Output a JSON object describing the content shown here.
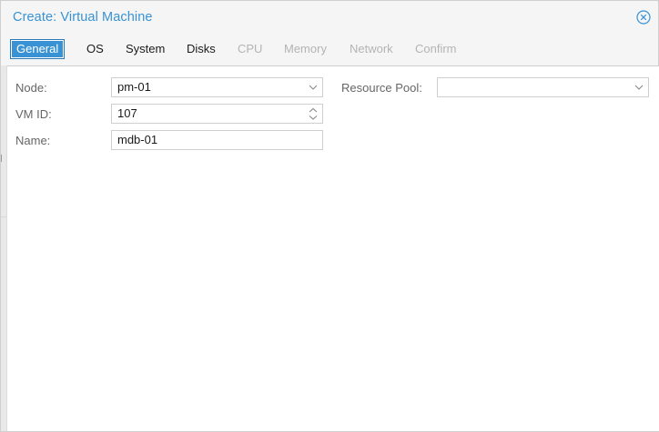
{
  "window": {
    "title": "Create: Virtual Machine"
  },
  "tabs": [
    {
      "label": "General",
      "active": true,
      "enabled": true
    },
    {
      "label": "OS",
      "active": false,
      "enabled": true
    },
    {
      "label": "System",
      "active": false,
      "enabled": true
    },
    {
      "label": "Disks",
      "active": false,
      "enabled": true
    },
    {
      "label": "CPU",
      "active": false,
      "enabled": false
    },
    {
      "label": "Memory",
      "active": false,
      "enabled": false
    },
    {
      "label": "Network",
      "active": false,
      "enabled": false
    },
    {
      "label": "Confirm",
      "active": false,
      "enabled": false
    }
  ],
  "form": {
    "node": {
      "label": "Node:",
      "value": "pm-01"
    },
    "vmid": {
      "label": "VM ID:",
      "value": "107"
    },
    "name": {
      "label": "Name:",
      "value": "mdb-01"
    },
    "resource_pool": {
      "label": "Resource Pool:",
      "value": ""
    }
  },
  "colors": {
    "accent": "#3892d4",
    "disabled_text": "#b4b4b4",
    "label_text": "#666666"
  },
  "icons": {
    "close": "close-circle-icon",
    "dropdown": "chevron-down-icon",
    "spinner": "spinner-updown-icon"
  }
}
